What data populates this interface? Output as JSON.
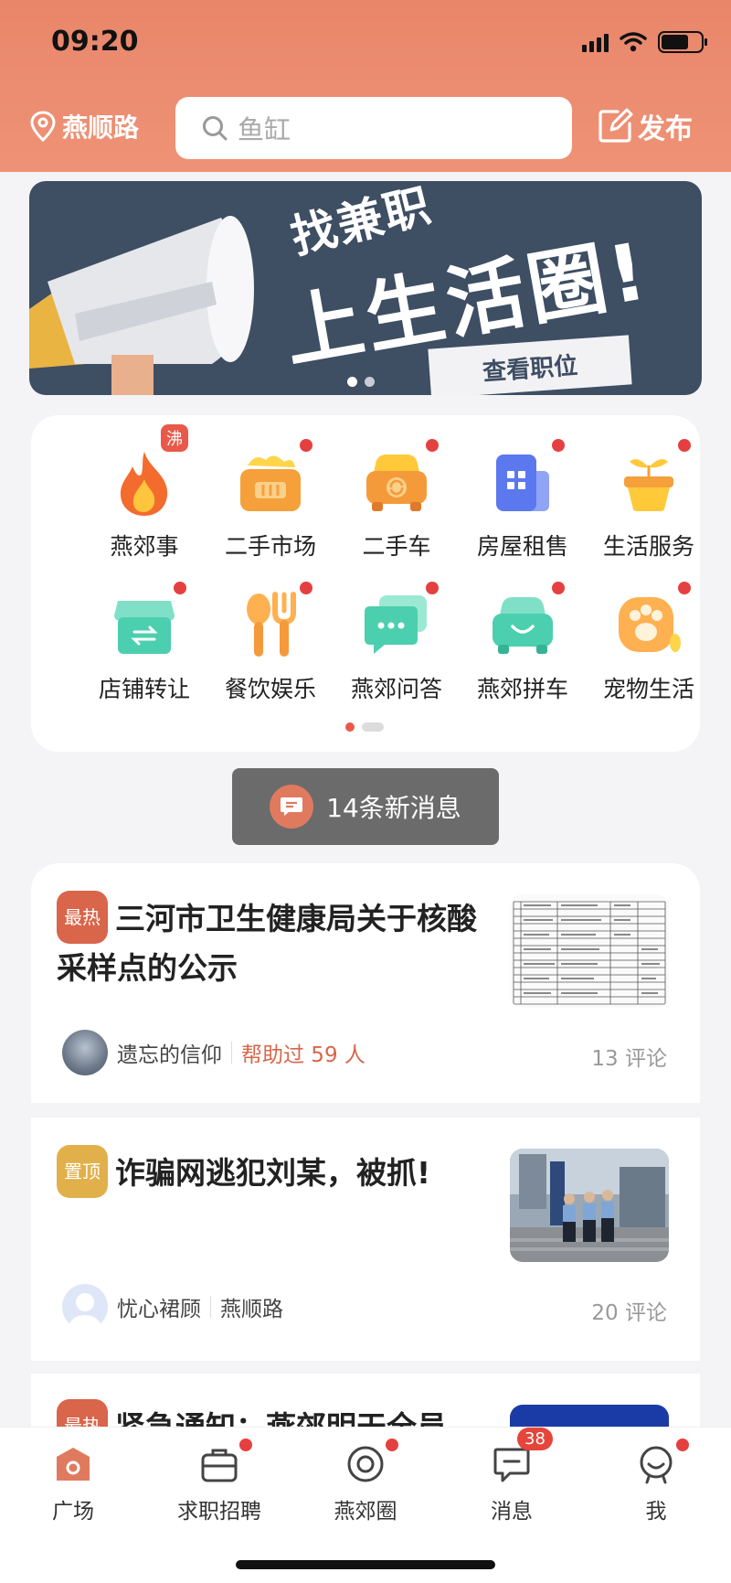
{
  "status": {
    "time": "09:20"
  },
  "header": {
    "location": "燕顺路",
    "search_placeholder": "鱼缸",
    "publish_label": "发布"
  },
  "banner": {
    "title_line1": "找兼职",
    "title_line2": "上生活圈!",
    "button": "查看职位",
    "page_count": 2,
    "active_page": 1
  },
  "categories": [
    {
      "label": "燕郊事",
      "icon": "fire-icon",
      "hot_tag": "沸"
    },
    {
      "label": "二手市场",
      "icon": "basket-icon"
    },
    {
      "label": "二手车",
      "icon": "car-icon"
    },
    {
      "label": "房屋租售",
      "icon": "building-icon"
    },
    {
      "label": "生活服务",
      "icon": "plant-pot-icon"
    },
    {
      "label": "店铺转让",
      "icon": "shop-icon"
    },
    {
      "label": "餐饮娱乐",
      "icon": "spoon-fork-icon"
    },
    {
      "label": "燕郊问答",
      "icon": "chat-bubbles-icon"
    },
    {
      "label": "燕郊拼车",
      "icon": "carpool-icon"
    },
    {
      "label": "宠物生活",
      "icon": "paw-icon"
    }
  ],
  "toast": {
    "text": "14条新消息"
  },
  "posts": [
    {
      "tag": "最热",
      "title": "三河市卫生健康局关于核酸采样点的公示",
      "author": "遗忘的信仰",
      "extra": "帮助过 59 人",
      "comments": "13 评论"
    },
    {
      "tag": "置顶",
      "title": "诈骗网逃犯刘某，被抓!",
      "author": "忧心裙顾",
      "extra": "燕顺路",
      "comments": "20 评论"
    },
    {
      "tag": "最热",
      "title": "紧急通知：燕郊明天全员"
    }
  ],
  "tabbar": [
    {
      "label": "广场",
      "icon": "home-square-icon",
      "active": true
    },
    {
      "label": "求职招聘",
      "icon": "briefcase-icon"
    },
    {
      "label": "燕郊圈",
      "icon": "circle-target-icon"
    },
    {
      "label": "消息",
      "icon": "message-icon",
      "badge": "38"
    },
    {
      "label": "我",
      "icon": "profile-face-icon"
    }
  ],
  "colors": {
    "accent": "#e9866a",
    "hot": "#d9654a",
    "top": "#e2b04a",
    "dot": "#e54040"
  }
}
